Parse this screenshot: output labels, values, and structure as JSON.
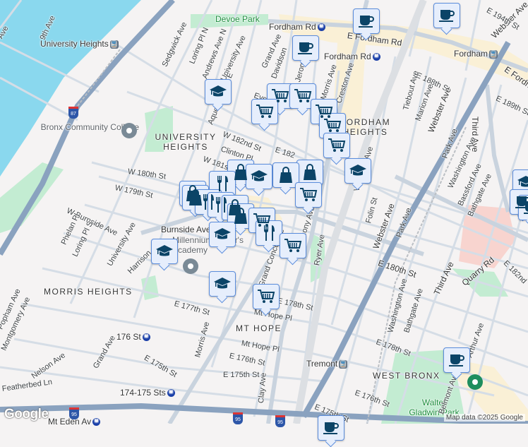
{
  "map": {
    "colors": {
      "water": "#8ad8ee",
      "park": "#c3ecd2",
      "highway": "#8aa2bf",
      "road": "#d5dde6",
      "commercial": "#faf0d6",
      "marker_bg": "#e6eefc",
      "marker_border": "#5b8ddc",
      "icon": "#0b4467"
    },
    "neighborhoods": [
      "UNIVERSITY HEIGHTS",
      "FORDHAM HEIGHTS",
      "MORRIS HEIGHTS",
      "MT HOPE",
      "WEST BRONX"
    ],
    "parks": [
      "Devoe Park",
      "Walter Gladwin Park"
    ],
    "places": {
      "college": "Bronx Community College",
      "academy": "Millennium Driver's Academy"
    },
    "stations": {
      "university_heights": "University Heights",
      "fordham_rd_1": "Fordham Rd",
      "fordham_rd_2": "Fordham Rd",
      "fordham": "Fordham",
      "st176": "176 St",
      "st174": "174-175 Sts",
      "tremont": "Tremont",
      "mt_eden": "Mt Eden Av"
    },
    "streets": {
      "s1": "Ave",
      "s2": "9th Ave",
      "s3": "Sedgwick Ave",
      "s4": "Loring Pl N",
      "s5": "Andrews Ave N",
      "s6": "University Ave",
      "s7": "Aqueduct Ave E",
      "s8": "W 182nd St",
      "s9": "Clinton Pl",
      "s10": "W 181st",
      "s11": "W 180th St",
      "s12": "W 179th St",
      "s13": "W Burnside Ave",
      "s14": "Burnside Ave",
      "s15": "Phelan Pl",
      "s16": "Loring Pl S",
      "s17": "University Ave",
      "s18": "Harrison",
      "s19": "Popham Ave",
      "s20": "Montgomery Ave",
      "s21": "Nelson Ave",
      "s22": "Grand Ave",
      "s23": "Featherbed Ln",
      "s24": "E 177th St",
      "s25": "Morris Ave",
      "s26": "E 175th St",
      "s27": "E 176th St",
      "s28": "E 175th St",
      "s29": "Mt Hope Pl",
      "s30": "Clay Ave",
      "s31": "Grand Concourse",
      "s32": "E 178th St",
      "s33": "Anthony Ave",
      "s34": "Ryer Ave",
      "s35": "Valentine Ave",
      "s36": "Folin St",
      "s37": "Webster Ave",
      "s38": "Park Ave",
      "s39": "Washington Ave",
      "s40": "Bathgate Ave",
      "s41": "E 180th St",
      "s42": "Third Ave",
      "s43": "Quarry Rd",
      "s44": "E 182nd",
      "s45": "E 178th St",
      "s46": "E 176th St",
      "s47": "E 175th St",
      "s48": "E Fordham Rd",
      "s49": "Grand Ave",
      "s50": "Davidson",
      "s51": "Jerome Ave",
      "s52": "Morris Ave",
      "s53": "Creston Ave",
      "s54": "E 188th St",
      "s55": "Tiebout Ave",
      "s56": "Marion Ave",
      "s57": "Webster Ave",
      "s58": "E 189th St",
      "s59": "Third Ave",
      "s60": "Park Ave",
      "s61": "Washington Ave",
      "s62": "Bassford Ave",
      "s63": "Bathgate Ave",
      "s64": "Webster Ave",
      "s65": "E Fordham",
      "s66": "E 194th St",
      "s67": "Evelyn Pl",
      "s68": "E 182",
      "s69": "Mt Hope Pl",
      "s70": "Belmont Ave",
      "s71": "Arthur Ave",
      "s72": "Quarry"
    },
    "highways": [
      "87",
      "95",
      "95",
      "95"
    ],
    "marker_types": {
      "coffee": "coffee-cup-icon",
      "school": "graduation-cap-icon",
      "grocery": "shopping-cart-icon",
      "shopping": "shopping-bag-icon",
      "restaurant": "fork-knife-icon"
    },
    "logo": "Google",
    "attribution": "Map data ©2025 Google"
  }
}
